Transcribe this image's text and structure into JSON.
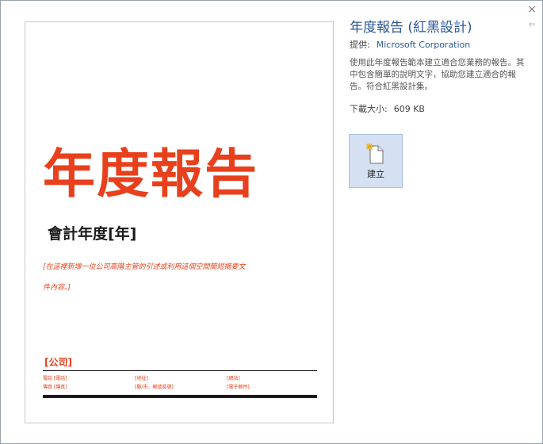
{
  "colors": {
    "accent_red": "#e8401c",
    "link_blue": "#2b579a"
  },
  "window": {
    "close_label": "×",
    "pin_label": "⇦"
  },
  "preview": {
    "title": "年度報告",
    "subtitle": "會計年度[年]",
    "description_line1": "[在這裡新增一位公司高階主管的引述或利用這個空間簡短摘要文",
    "description_line2": "件內容。]",
    "company": "[公司]",
    "footer": {
      "phone": "電話 [電話]",
      "fax": "傳真 [傳真]",
      "address": "[地址]",
      "city": "[縣/市，郵遞區號]",
      "website": "[網站]",
      "email": "[電子郵件]"
    }
  },
  "template": {
    "title": "年度報告 (紅黑設計)",
    "provider_label": "提供:",
    "provider_name": "Microsoft Corporation",
    "description": "使用此年度報告範本建立適合您業務的報告。其中包含簡單的說明文字，協助您建立適合的報告。符合紅黑設計集。",
    "size_label": "下載大小:",
    "size_value": "609 KB",
    "create_label": "建立"
  }
}
